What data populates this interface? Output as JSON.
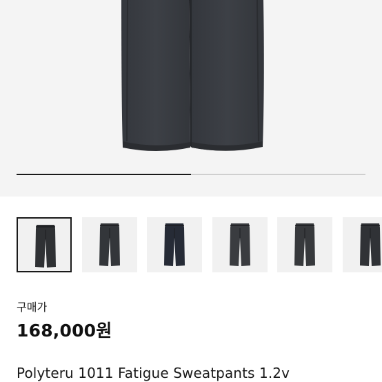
{
  "product_image": {
    "icon": "sweatpants-photo",
    "carousel_progress": 0.5
  },
  "thumbnails": [
    {
      "icon": "sweatpants-thumbnail",
      "color": "#2f3134",
      "selected": true
    },
    {
      "icon": "sweatpants-thumbnail",
      "color": "#33363a",
      "selected": false
    },
    {
      "icon": "sweatpants-thumbnail",
      "color": "#262b36",
      "selected": false
    },
    {
      "icon": "sweatpants-thumbnail",
      "color": "#3a3c40",
      "selected": false
    },
    {
      "icon": "sweatpants-thumbnail",
      "color": "#37393c",
      "selected": false
    },
    {
      "icon": "sweatpants-thumbnail",
      "color": "#303236",
      "selected": false
    }
  ],
  "price": {
    "label": "구매가",
    "value": "168,000원"
  },
  "product": {
    "title": "Polyteru 1011 Fatigue Sweatpants 1.2v"
  }
}
